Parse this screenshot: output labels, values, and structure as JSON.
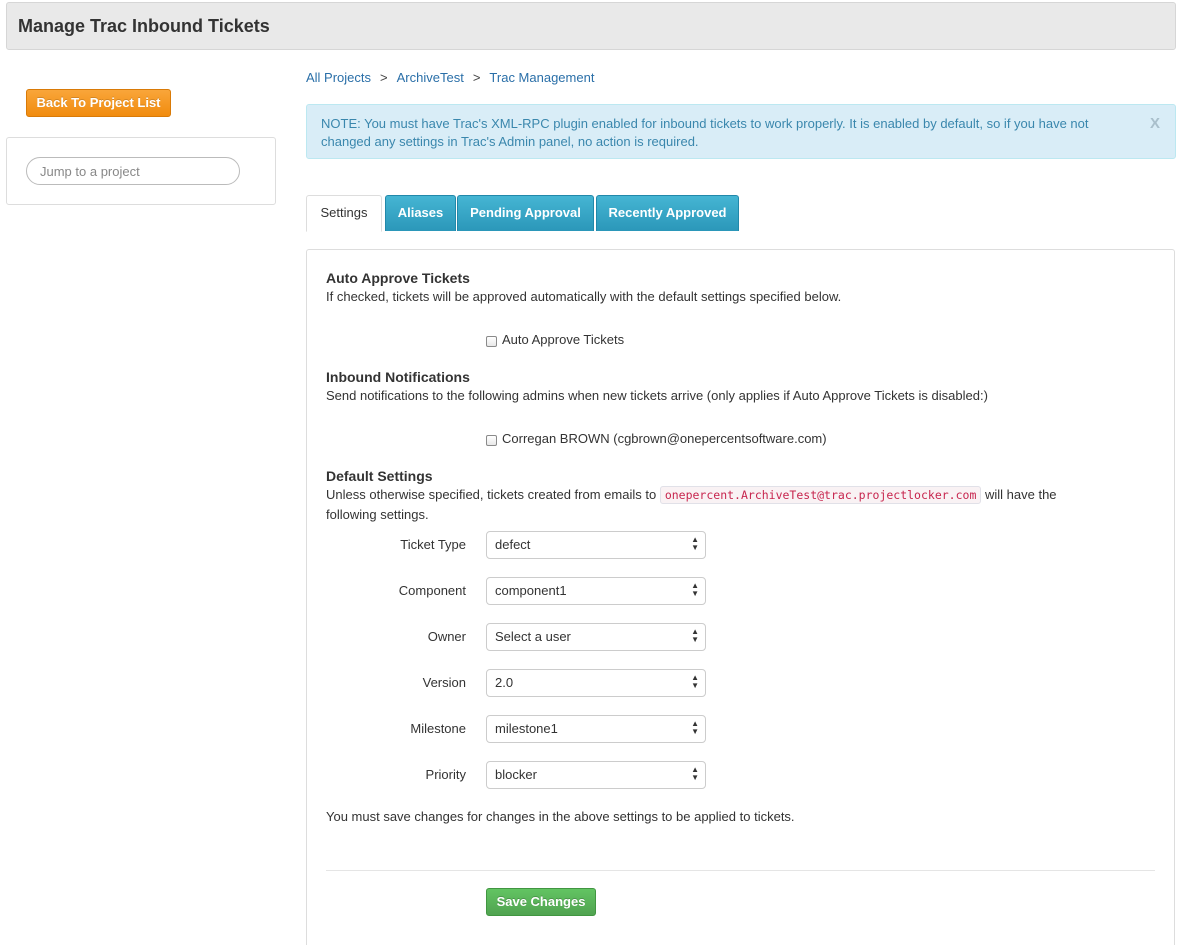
{
  "page": {
    "title": "Manage Trac Inbound Tickets"
  },
  "sidebar": {
    "back_button": "Back To Project List",
    "jump_placeholder": "Jump to a project"
  },
  "breadcrumb": {
    "items": [
      "All Projects",
      "ArchiveTest",
      "Trac Management"
    ],
    "separator": ">"
  },
  "note": {
    "text": "NOTE: You must have Trac's XML-RPC plugin enabled for inbound tickets to work properly. It is enabled by default, so if you have not changed any settings in Trac's Admin panel, no action is required.",
    "close": "X"
  },
  "tabs": [
    {
      "label": "Settings",
      "active": true
    },
    {
      "label": "Aliases",
      "active": false
    },
    {
      "label": "Pending Approval",
      "active": false
    },
    {
      "label": "Recently Approved",
      "active": false
    }
  ],
  "auto_approve": {
    "title": "Auto Approve Tickets",
    "description": "If checked, tickets will be approved automatically with the default settings specified below.",
    "checkbox_label": "Auto Approve Tickets",
    "checked": false
  },
  "notifications": {
    "title": "Inbound Notifications",
    "description": "Send notifications to the following admins when new tickets arrive (only applies if Auto Approve Tickets is disabled:)",
    "admins": [
      {
        "label": "Corregan BROWN (cgbrown@onepercentsoftware.com)",
        "checked": false
      }
    ]
  },
  "defaults": {
    "title": "Default Settings",
    "desc_before": "Unless otherwise specified, tickets created from emails to",
    "email": "onepercent.ArchiveTest@trac.projectlocker.com",
    "desc_after": "will have the",
    "desc_line2": "following settings.",
    "fields": [
      {
        "label": "Ticket Type",
        "value": "defect"
      },
      {
        "label": "Component",
        "value": "component1"
      },
      {
        "label": "Owner",
        "value": "Select a user"
      },
      {
        "label": "Version",
        "value": "2.0"
      },
      {
        "label": "Milestone",
        "value": "milestone1"
      },
      {
        "label": "Priority",
        "value": "blocker"
      }
    ],
    "save_note": "You must save changes for changes in the above settings to be applied to tickets."
  },
  "actions": {
    "save_label": "Save Changes"
  },
  "colors": {
    "accent_orange": "#f18c0e",
    "tab_blue": "#2b97b9",
    "save_green": "#51a351",
    "note_bg": "#d9edf7",
    "link": "#2a6fa8"
  }
}
